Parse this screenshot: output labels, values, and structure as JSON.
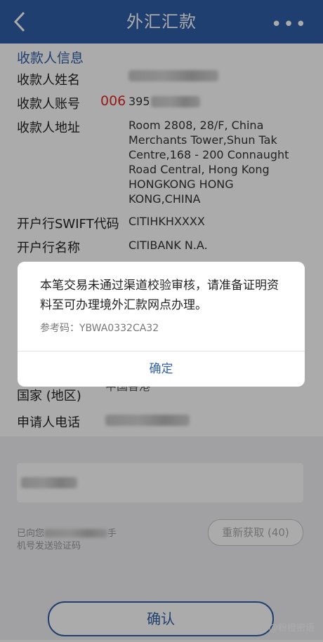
{
  "nav": {
    "title": "外汇汇款",
    "back_icon": "chevron-left-icon",
    "more_icon": "more-dots-icon"
  },
  "payee": {
    "section_title": "收款人信息",
    "name_label": "收款人姓名",
    "account_label": "收款人账号",
    "account_prefix": "006",
    "account_partial": "395",
    "address_label": "收款人地址",
    "address_lines": [
      "Room 2808, 28/F, China",
      "Merchants Tower,Shun Tak",
      "Centre,168 - 200 Connaught",
      "Road Central, Hong Kong",
      "HONGKONG HONG",
      "KONG,CHINA"
    ],
    "swift_label": "开户行SWIFT代码",
    "swift_value": "CITIHKHXXXX",
    "bank_label": "开户行名称",
    "bank_value": "CITIBANK N.A.",
    "country_label": "国家 (地区)",
    "country_value": "中国香港",
    "phone_label": "申请人电话"
  },
  "verify": {
    "sms_prefix": "已向您",
    "sms_mid": "手",
    "sms_suffix": "机号发送验证码",
    "refetch_label": "重新获取 (40)"
  },
  "confirm_label": "确认",
  "watermark": "知乎 @粉橙密语",
  "dialog": {
    "message": "本笔交易未通过渠道校验审核，请准备证明资料至可办理境外汇款网点办理。",
    "reference": "参考码：YBWA0332CA32",
    "ok_label": "确定"
  },
  "colors": {
    "brand": "#2f5fa8",
    "accent_red": "#e02828"
  }
}
